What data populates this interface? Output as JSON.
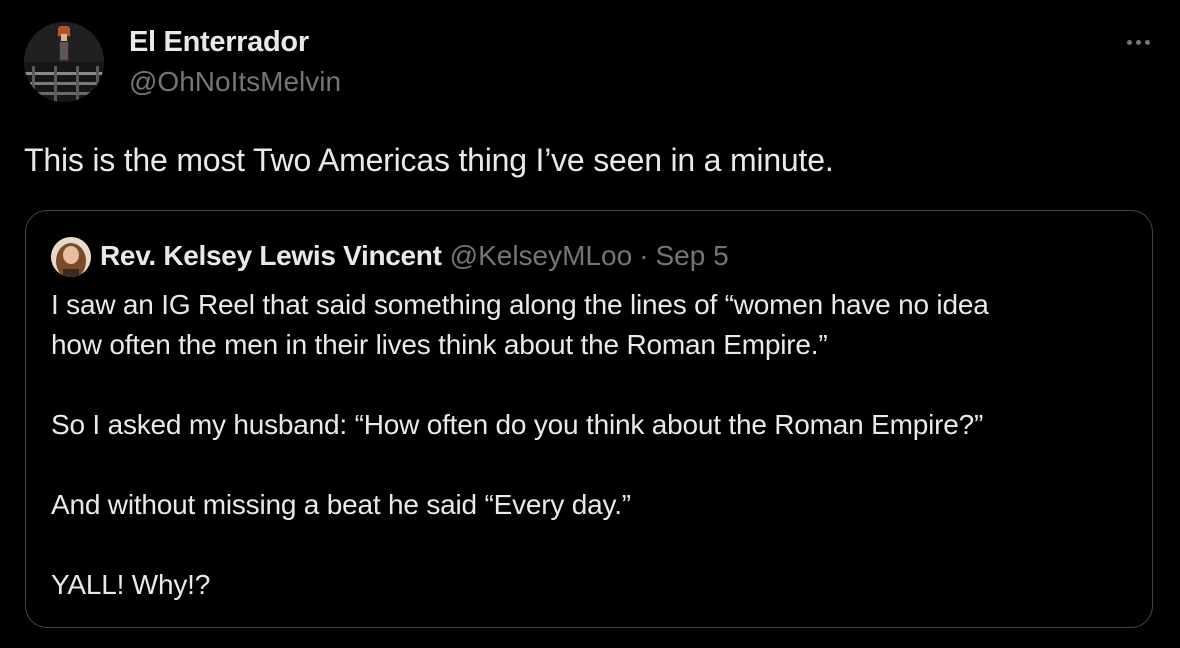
{
  "tweet": {
    "author_name": "El Enterrador",
    "author_handle": "@OhNoItsMelvin",
    "more_icon": "more-horizontal-icon",
    "text": "This is the most Two Americas thing I’ve seen in a minute."
  },
  "quote": {
    "author_name": "Rev. Kelsey Lewis Vincent",
    "author_handle": "@KelseyMLoo",
    "separator": "·",
    "date": "Sep 5",
    "lines": [
      "I saw an IG Reel that said something along the lines of “women have no idea",
      "how often the men in their lives think about the Roman Empire.”",
      "So I asked my husband: “How often do you think about the Roman Empire?”",
      "And without missing a beat he said “Every day.”",
      "YALL! Why!?"
    ]
  },
  "colors": {
    "background": "#000000",
    "primary_text": "#e7e9ea",
    "secondary_text": "#71767b",
    "card_border": "#3f4448"
  }
}
